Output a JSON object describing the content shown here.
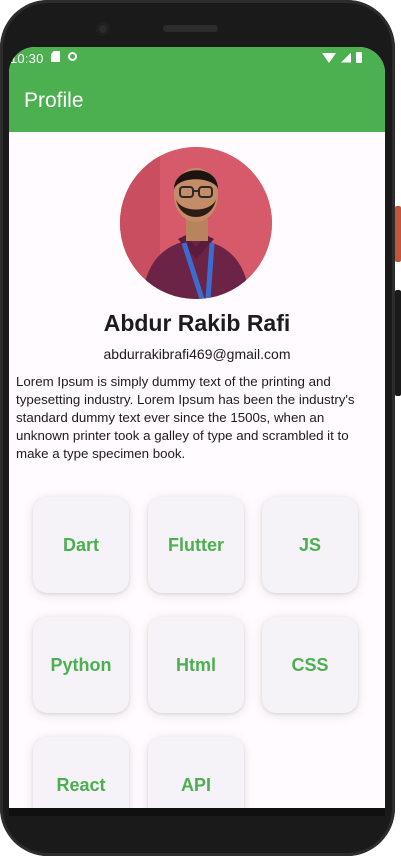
{
  "status_bar": {
    "time": "10:30",
    "left_icons": [
      "sd-card-icon",
      "circle-notification-icon"
    ],
    "right_icons": [
      "wifi-icon",
      "signal-icon",
      "battery-icon"
    ]
  },
  "app_bar": {
    "title": "Profile"
  },
  "profile": {
    "avatar": "profile-photo",
    "name": "Abdur Rakib Rafi",
    "email": "abdurrakibrafi469@gmail.com",
    "bio": "Lorem Ipsum is simply dummy text of the printing and typesetting industry. Lorem Ipsum has been the industry's standard dummy text ever since the 1500s, when an unknown printer took a galley of type and scrambled it to make a type specimen book."
  },
  "skills": [
    "Dart",
    "Flutter",
    "JS",
    "Python",
    "Html",
    "CSS",
    "React",
    "API"
  ],
  "colors": {
    "accent": "#4caf50",
    "card": "#f6f3f8",
    "background": "#fffbfe"
  }
}
